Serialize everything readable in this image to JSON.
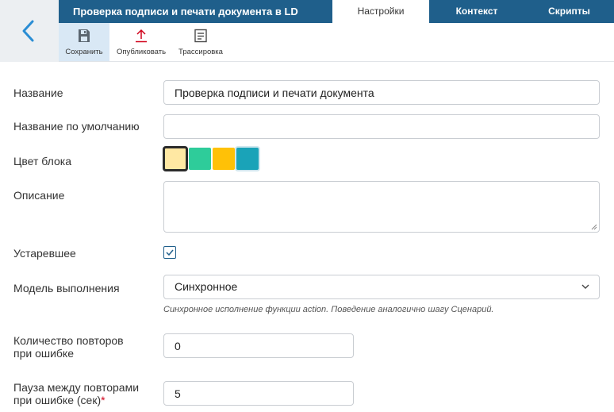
{
  "header": {
    "title": "Проверка подписи и печати документа в LD",
    "tabs": [
      {
        "label": "Настройки",
        "active": true
      },
      {
        "label": "Контекст",
        "active": false
      },
      {
        "label": "Скрипты",
        "active": false
      }
    ],
    "back_icon": "chevron-left-icon"
  },
  "toolbar": {
    "save_label": "Сохранить",
    "publish_label": "Опубликовать",
    "trace_label": "Трассировка"
  },
  "form": {
    "name_label": "Название",
    "name_value": "Проверка подписи и печати документа",
    "default_name_label": "Название по умолчанию",
    "default_name_value": "",
    "color_label": "Цвет блока",
    "colors": [
      "#ffe8a3",
      "#2ecc9a",
      "#ffc107",
      "#1aa3b8"
    ],
    "selected_color_index": 0,
    "description_label": "Описание",
    "description_value": "",
    "obsolete_label": "Устаревшее",
    "obsolete_checked": true,
    "execution_model_label": "Модель выполнения",
    "execution_model_value": "Синхронное",
    "execution_model_hint": "Синхронное исполнение функции action. Поведение аналогично шагу Сценарий.",
    "retries_label_line1": "Количество повторов",
    "retries_label_line2": "при ошибке",
    "retries_value": "0",
    "pause_label_line1": "Пауза между повторами",
    "pause_label_line2": "при ошибке (сек)",
    "pause_required_mark": "*",
    "pause_value": "5"
  },
  "colors": {
    "header_bg": "#1f5f8b",
    "accent": "#2a8dd4",
    "publish_icon": "#d0021b"
  }
}
